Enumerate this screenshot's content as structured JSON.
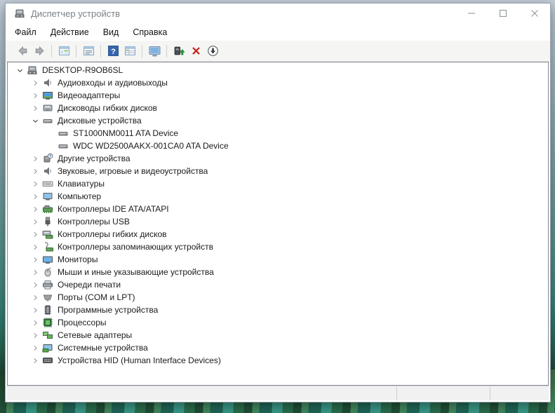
{
  "window": {
    "title": "Диспетчер устройств",
    "app_icon": "device-manager",
    "controls": [
      {
        "id": "minimize",
        "icon": "minimize"
      },
      {
        "id": "maximize",
        "icon": "maximize"
      },
      {
        "id": "close",
        "icon": "close"
      }
    ]
  },
  "menu": {
    "items": [
      {
        "id": "file",
        "label": "Файл"
      },
      {
        "id": "action",
        "label": "Действие"
      },
      {
        "id": "view",
        "label": "Вид"
      },
      {
        "id": "help",
        "label": "Справка"
      }
    ]
  },
  "toolbar": {
    "groups": [
      [
        {
          "id": "back",
          "icon": "arrow-left"
        },
        {
          "id": "forward",
          "icon": "arrow-right"
        }
      ],
      [
        {
          "id": "show-console-tree",
          "icon": "console-window"
        }
      ],
      [
        {
          "id": "properties",
          "icon": "properties-window"
        }
      ],
      [
        {
          "id": "help",
          "icon": "help"
        },
        {
          "id": "items-view",
          "icon": "list-window"
        }
      ],
      [
        {
          "id": "scan-hardware-changes",
          "icon": "scan-monitor"
        }
      ],
      [
        {
          "id": "update-driver",
          "icon": "update-driver"
        },
        {
          "id": "uninstall-device",
          "icon": "uninstall-cross"
        },
        {
          "id": "disable-device",
          "icon": "disable-arrow"
        }
      ]
    ]
  },
  "tree": {
    "items": [
      {
        "label": "DESKTOP-R9OB6SL",
        "icon": "computer-root",
        "level": 1,
        "state": "expanded"
      },
      {
        "label": "Аудиовходы и аудиовыходы",
        "icon": "audio-device",
        "level": 2,
        "state": "collapsed"
      },
      {
        "label": "Видеоадаптеры",
        "icon": "display-adapter",
        "level": 2,
        "state": "collapsed"
      },
      {
        "label": "Дисководы гибких дисков",
        "icon": "floppy-drive",
        "level": 2,
        "state": "collapsed"
      },
      {
        "label": "Дисковые устройства",
        "icon": "disk-drive",
        "level": 2,
        "state": "expanded"
      },
      {
        "label": "ST1000NM0011 ATA Device",
        "icon": "disk-drive",
        "level": 3,
        "state": "leaf"
      },
      {
        "label": "WDC WD2500AAKX-001CA0 ATA Device",
        "icon": "disk-drive",
        "level": 3,
        "state": "leaf"
      },
      {
        "label": "Другие устройства",
        "icon": "unknown-device",
        "level": 2,
        "state": "collapsed"
      },
      {
        "label": "Звуковые, игровые и видеоустройства",
        "icon": "audio-device",
        "level": 2,
        "state": "collapsed"
      },
      {
        "label": "Клавиатуры",
        "icon": "keyboard",
        "level": 2,
        "state": "collapsed"
      },
      {
        "label": "Компьютер",
        "icon": "computer-category",
        "level": 2,
        "state": "collapsed"
      },
      {
        "label": "Контроллеры IDE ATA/ATAPI",
        "icon": "ide-controller",
        "level": 2,
        "state": "collapsed"
      },
      {
        "label": "Контроллеры USB",
        "icon": "usb-controller",
        "level": 2,
        "state": "collapsed"
      },
      {
        "label": "Контроллеры гибких дисков",
        "icon": "floppy-controller",
        "level": 2,
        "state": "collapsed"
      },
      {
        "label": "Контроллеры запоминающих устройств",
        "icon": "storage-controller",
        "level": 2,
        "state": "collapsed"
      },
      {
        "label": "Мониторы",
        "icon": "monitor",
        "level": 2,
        "state": "collapsed"
      },
      {
        "label": "Мыши и иные указывающие устройства",
        "icon": "mouse",
        "level": 2,
        "state": "collapsed"
      },
      {
        "label": "Очереди печати",
        "icon": "printer",
        "level": 2,
        "state": "collapsed"
      },
      {
        "label": "Порты (COM и LPT)",
        "icon": "port-connector",
        "level": 2,
        "state": "collapsed"
      },
      {
        "label": "Программные устройства",
        "icon": "software-device",
        "level": 2,
        "state": "collapsed"
      },
      {
        "label": "Процессоры",
        "icon": "processor",
        "level": 2,
        "state": "collapsed"
      },
      {
        "label": "Сетевые адаптеры",
        "icon": "network-adapter",
        "level": 2,
        "state": "collapsed"
      },
      {
        "label": "Системные устройства",
        "icon": "system-device",
        "level": 2,
        "state": "collapsed"
      },
      {
        "label": "Устройства HID (Human Interface Devices)",
        "icon": "hid-device",
        "level": 2,
        "state": "collapsed"
      }
    ]
  },
  "status_bar": {
    "text": ""
  },
  "colors": {
    "help_blue": "#3466b0",
    "uninstall_red": "#c5261c",
    "update_green": "#2eaf3f",
    "pcb_green": "#58a44e",
    "screen_blue": "#6fb1e8",
    "title_text": "#7b8187",
    "toolbar_bg": "#f5f5f4",
    "status_bg": "#f1f1f1"
  }
}
